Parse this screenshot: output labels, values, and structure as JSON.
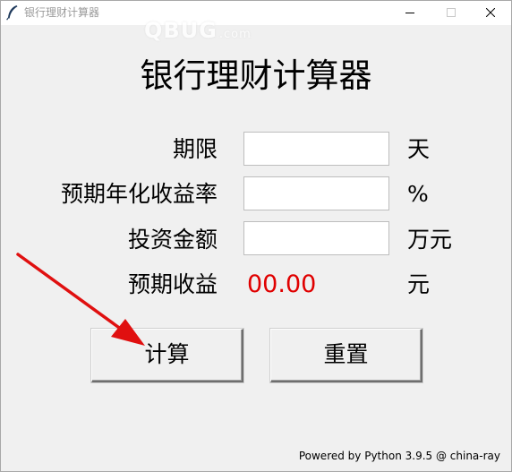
{
  "window": {
    "title": "银行理财计算器",
    "watermark_main": "QBUG",
    "watermark_suffix": ".com",
    "icons": {
      "app": "feather-icon",
      "minimize": "minimize-icon",
      "maximize": "maximize-icon",
      "close": "close-icon"
    }
  },
  "heading": "银行理财计算器",
  "form": {
    "rows": [
      {
        "label": "期限",
        "value": "",
        "unit": "天"
      },
      {
        "label": "预期年化收益率",
        "value": "",
        "unit": "%"
      },
      {
        "label": "投资金额",
        "value": "",
        "unit": "万元"
      }
    ],
    "result": {
      "label": "预期收益",
      "value": "00.00",
      "unit": "元"
    }
  },
  "buttons": {
    "calculate": "计算",
    "reset": "重置"
  },
  "footer": "Powered by Python 3.9.5 @ china-ray",
  "colors": {
    "result_value": "#e00000",
    "annotation_arrow": "#e01010",
    "window_bg": "#f0f0f0"
  }
}
